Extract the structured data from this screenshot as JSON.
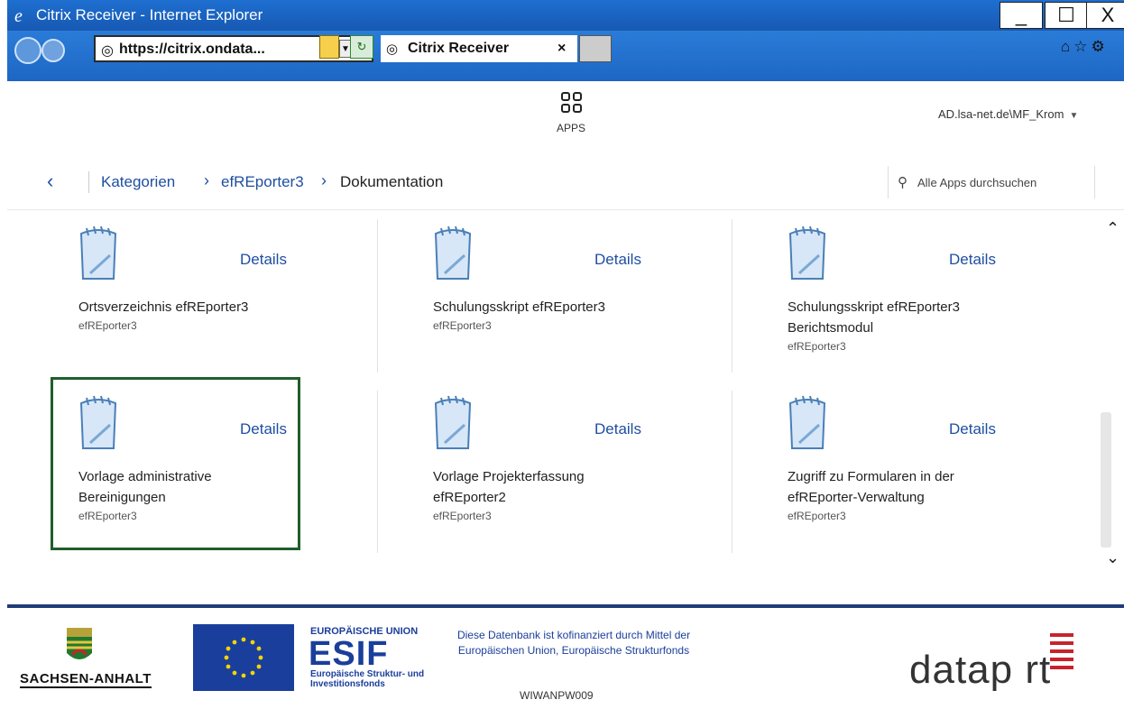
{
  "window": {
    "title": "Citrix Receiver - Internet Explorer",
    "min": "_",
    "max": "☐",
    "close": "X"
  },
  "browser": {
    "url": "https://citrix.ondata...",
    "tab_title": "Citrix Receiver",
    "tab_close": "×"
  },
  "header": {
    "apps_label": "APPS",
    "user": "AD.lsa-net.de\\MF_Krom",
    "user_caret": "▼"
  },
  "breadcrumb": {
    "back": "‹",
    "items": [
      "Kategorien",
      "efREporter3",
      "Dokumentation"
    ],
    "chevron": "›"
  },
  "search": {
    "placeholder": "Alle Apps durchsuchen"
  },
  "tiles": [
    {
      "details": "Details",
      "title": "Ortsverzeichnis efREporter3",
      "subtitle": "efREporter3"
    },
    {
      "details": "Details",
      "title": "Schulungsskript efREporter3",
      "subtitle": "efREporter3"
    },
    {
      "details": "Details",
      "title": "Schulungsskript efREporter3 Berichtsmodul",
      "subtitle": "efREporter3"
    },
    {
      "details": "Details",
      "title": "Vorlage administrative Bereinigungen",
      "subtitle": "efREporter3"
    },
    {
      "details": "Details",
      "title": "Vorlage Projekterfassung efREporter2",
      "subtitle": "efREporter3"
    },
    {
      "details": "Details",
      "title": "Zugriff zu Formularen in der efREporter-Verwaltung",
      "subtitle": "efREporter3"
    }
  ],
  "scroll": {
    "up": "⌃",
    "down": "⌄"
  },
  "footer": {
    "state": "SACHSEN-ANHALT",
    "eu_top": "EUROPÄISCHE UNION",
    "esif": "ESIF",
    "eu_sub": "Europäische Struktur- und Investitionsfonds",
    "cofin": "Diese Datenbank ist kofinanziert durch Mittel der Europäischen Union, Europäische Strukturfonds",
    "server": "WIWANPW009",
    "dataport": "datap rt"
  },
  "colors": {
    "titlebar": "#1759b3",
    "link": "#1f4fa0",
    "selection": "#1f5f2a",
    "footer_line": "#1d3c7a",
    "eu_blue": "#1a3e9b",
    "dataport_red": "#c8232c"
  }
}
